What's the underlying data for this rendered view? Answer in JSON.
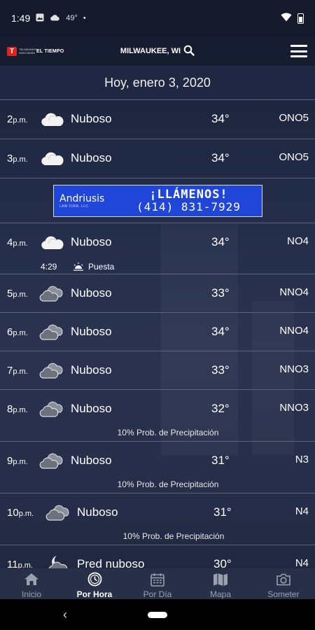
{
  "status_bar": {
    "time": "1:49",
    "temp": "49°",
    "dot": "•"
  },
  "header": {
    "logo_small": "TELEMUNDO WISCONSIN",
    "logo_text": "EL TIEMPO",
    "location": "MILWAUKEE, WI"
  },
  "date_label": "Hoy, enero 3, 2020",
  "rows": [
    {
      "hour": "2",
      "ampm": "p.m.",
      "icon": "cloudy-white-icon",
      "condition": "Nuboso",
      "temp": "34°",
      "wind": "ONO5"
    },
    {
      "hour": "3",
      "ampm": "p.m.",
      "icon": "cloudy-white-icon",
      "condition": "Nuboso",
      "temp": "34°",
      "wind": "ONO5"
    },
    {
      "hour": "4",
      "ampm": "p.m.",
      "icon": "cloudy-white-icon",
      "condition": "Nuboso",
      "temp": "34°",
      "wind": "NO4",
      "sunset_time": "4:29",
      "sunset_label": "Puesta"
    },
    {
      "hour": "5",
      "ampm": "p.m.",
      "icon": "cloudy-gray-icon",
      "condition": "Nuboso",
      "temp": "33°",
      "wind": "NNO4"
    },
    {
      "hour": "6",
      "ampm": "p.m.",
      "icon": "cloudy-gray-icon",
      "condition": "Nuboso",
      "temp": "34°",
      "wind": "NNO4"
    },
    {
      "hour": "7",
      "ampm": "p.m.",
      "icon": "cloudy-gray-icon",
      "condition": "Nuboso",
      "temp": "33°",
      "wind": "NNO3"
    },
    {
      "hour": "8",
      "ampm": "p.m.",
      "icon": "cloudy-gray-icon",
      "condition": "Nuboso",
      "temp": "32°",
      "wind": "NNO3",
      "precip": "10% Prob. de Precipitación"
    },
    {
      "hour": "9",
      "ampm": "p.m.",
      "icon": "cloudy-gray-icon",
      "condition": "Nuboso",
      "temp": "31°",
      "wind": "N3",
      "precip": "10% Prob. de Precipitación"
    },
    {
      "hour": "10",
      "ampm": "p.m.",
      "icon": "cloudy-gray-icon",
      "condition": "Nuboso",
      "temp": "31°",
      "wind": "N4",
      "precip": "10% Prob. de Precipitación"
    },
    {
      "hour": "11",
      "ampm": "p.m.",
      "icon": "partly-cloudy-night-icon",
      "condition": "Pred nuboso",
      "temp": "30°",
      "wind": "N4"
    }
  ],
  "ad": {
    "brand": "Andriusis",
    "brand_sub": "LAW FIRM, LLC",
    "headline": "¡LLÁMENOS!",
    "phone": "(414) 831-7929"
  },
  "bottom_nav": [
    {
      "label": "Inicio",
      "icon": "home-icon",
      "active": false
    },
    {
      "label": "Por Hora",
      "icon": "clock-icon",
      "active": true
    },
    {
      "label": "Por Día",
      "icon": "calendar-icon",
      "active": false
    },
    {
      "label": "Mapa",
      "icon": "map-icon",
      "active": false
    },
    {
      "label": "Someter",
      "icon": "camera-icon",
      "active": false
    }
  ],
  "colors": {
    "background": "#1d2640",
    "divider": "#5c6378",
    "ad_blue": "#1f46d8",
    "brand_red": "#e2231a",
    "nav_inactive": "#9aa0ad"
  }
}
